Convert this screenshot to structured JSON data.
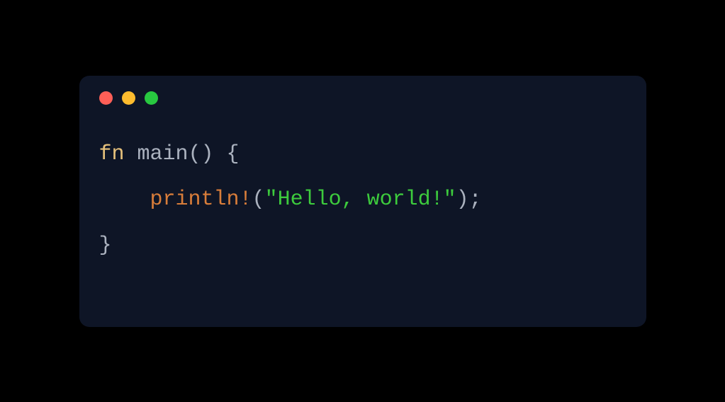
{
  "window": {
    "traffic_lights": {
      "close_color": "#ff5f57",
      "minimize_color": "#febc2e",
      "zoom_color": "#28c840"
    }
  },
  "code": {
    "lines": [
      {
        "tokens": [
          {
            "kind": "keyword",
            "text": "fn "
          },
          {
            "kind": "fn",
            "text": "main"
          },
          {
            "kind": "punct",
            "text": "() {"
          }
        ]
      },
      {
        "tokens": [
          {
            "kind": "punct",
            "text": "    "
          },
          {
            "kind": "macro",
            "text": "println!"
          },
          {
            "kind": "punct",
            "text": "("
          },
          {
            "kind": "string",
            "text": "\"Hello, world!\""
          },
          {
            "kind": "punct",
            "text": ");"
          }
        ]
      },
      {
        "tokens": [
          {
            "kind": "punct",
            "text": "}"
          }
        ]
      }
    ]
  }
}
